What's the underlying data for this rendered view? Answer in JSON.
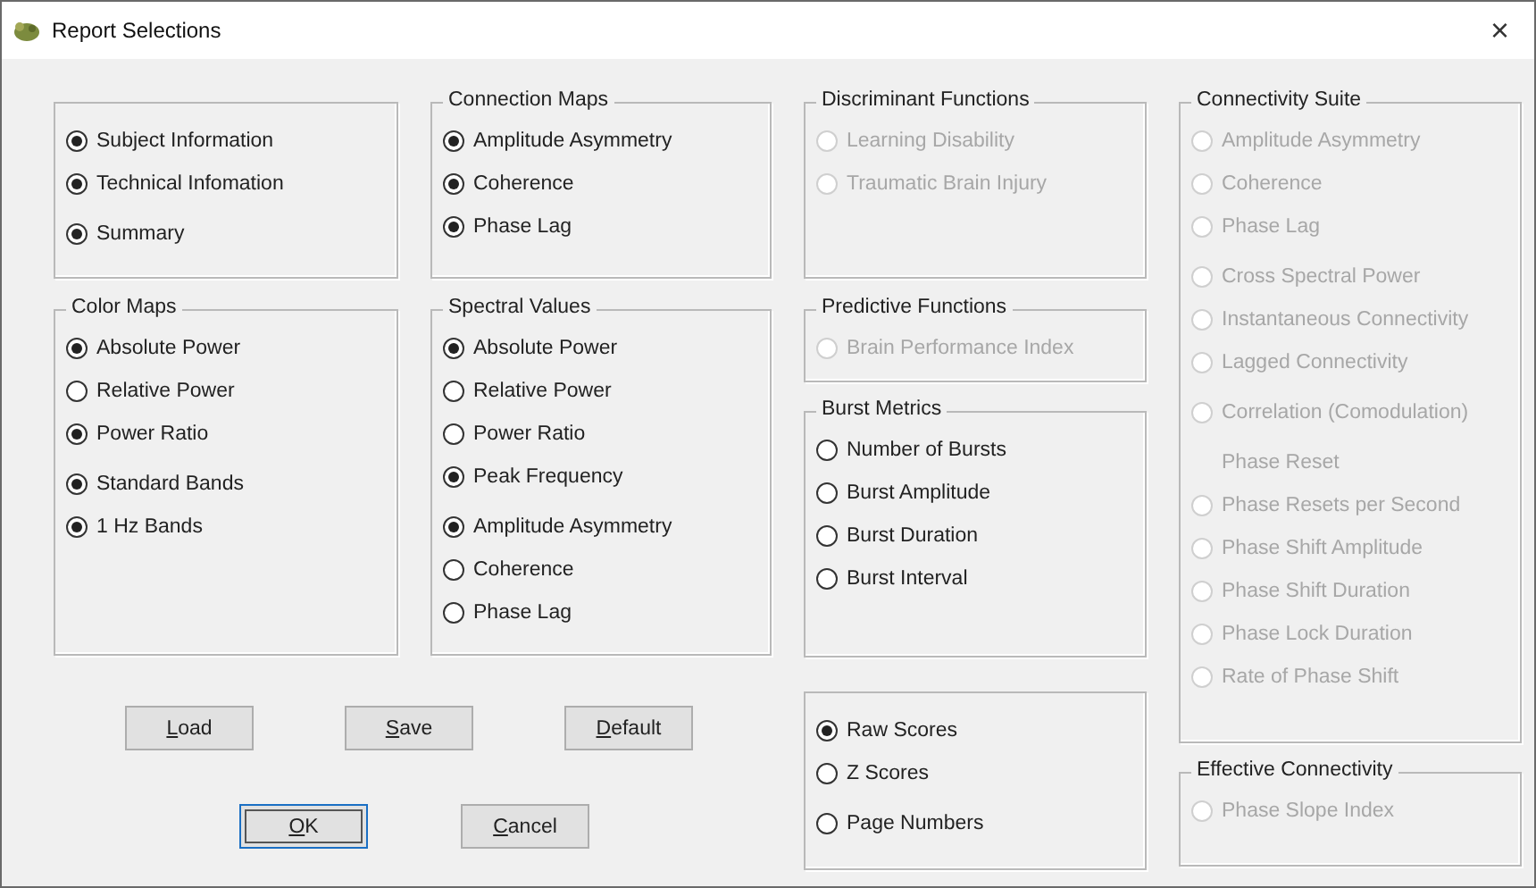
{
  "window": {
    "title": "Report Selections",
    "close": "×"
  },
  "columns": [
    {
      "groups": [
        {
          "sets": [
            [
              {
                "label": "Subject Information",
                "selected": true,
                "disabled": false
              },
              {
                "label": "Technical Infomation",
                "selected": true,
                "disabled": false
              }
            ],
            [
              {
                "label": "Summary",
                "selected": true,
                "disabled": false
              }
            ]
          ]
        },
        {
          "title": "Color Maps",
          "sets": [
            [
              {
                "label": "Absolute Power",
                "selected": true,
                "disabled": false
              },
              {
                "label": "Relative Power",
                "selected": false,
                "disabled": false
              },
              {
                "label": "Power Ratio",
                "selected": true,
                "disabled": false
              }
            ],
            [
              {
                "label": "Standard Bands",
                "selected": true,
                "disabled": false
              },
              {
                "label": "1 Hz Bands",
                "selected": true,
                "disabled": false
              }
            ]
          ]
        }
      ]
    },
    {
      "groups": [
        {
          "title": "Connection Maps",
          "sets": [
            [
              {
                "label": "Amplitude Asymmetry",
                "selected": true,
                "disabled": false
              },
              {
                "label": "Coherence",
                "selected": true,
                "disabled": false
              },
              {
                "label": "Phase Lag",
                "selected": true,
                "disabled": false
              }
            ]
          ]
        },
        {
          "title": "Spectral Values",
          "sets": [
            [
              {
                "label": "Absolute Power",
                "selected": true,
                "disabled": false
              },
              {
                "label": "Relative Power",
                "selected": false,
                "disabled": false
              },
              {
                "label": "Power Ratio",
                "selected": false,
                "disabled": false
              },
              {
                "label": "Peak Frequency",
                "selected": true,
                "disabled": false
              }
            ],
            [
              {
                "label": "Amplitude Asymmetry",
                "selected": true,
                "disabled": false
              },
              {
                "label": "Coherence",
                "selected": false,
                "disabled": false
              },
              {
                "label": "Phase Lag",
                "selected": false,
                "disabled": false
              }
            ]
          ]
        }
      ]
    },
    {
      "groups": [
        {
          "title": "Discriminant Functions",
          "sets": [
            [
              {
                "label": "Learning Disability",
                "selected": false,
                "disabled": true
              },
              {
                "label": "Traumatic Brain Injury",
                "selected": false,
                "disabled": true
              }
            ]
          ]
        },
        {
          "title": "Predictive Functions",
          "sets": [
            [
              {
                "label": "Brain Performance Index",
                "selected": false,
                "disabled": true
              }
            ]
          ]
        },
        {
          "title": "Burst Metrics",
          "sets": [
            [
              {
                "label": "Number of Bursts",
                "selected": false,
                "disabled": false
              },
              {
                "label": "Burst Amplitude",
                "selected": false,
                "disabled": false
              },
              {
                "label": "Burst Duration",
                "selected": false,
                "disabled": false
              },
              {
                "label": "Burst Interval",
                "selected": false,
                "disabled": false
              }
            ]
          ]
        },
        {
          "sets": [
            [
              {
                "label": "Raw Scores",
                "selected": true,
                "disabled": false
              },
              {
                "label": "Z Scores",
                "selected": false,
                "disabled": false
              }
            ],
            [
              {
                "label": "Page Numbers",
                "selected": false,
                "disabled": false
              }
            ]
          ]
        }
      ]
    },
    {
      "groups": [
        {
          "title": "Connectivity Suite",
          "sets": [
            [
              {
                "label": "Amplitude Asymmetry",
                "selected": false,
                "disabled": true
              },
              {
                "label": "Coherence",
                "selected": false,
                "disabled": true
              },
              {
                "label": "Phase Lag",
                "selected": false,
                "disabled": true
              }
            ],
            [
              {
                "label": "Cross Spectral Power",
                "selected": false,
                "disabled": true
              },
              {
                "label": "Instantaneous Connectivity",
                "selected": false,
                "disabled": true
              },
              {
                "label": "Lagged Connectivity",
                "selected": false,
                "disabled": true
              }
            ],
            [
              {
                "label": "Correlation (Comodulation)",
                "selected": false,
                "disabled": true
              }
            ],
            [
              {
                "kind": "label",
                "label": "Phase Reset",
                "disabled": true
              },
              {
                "label": "Phase Resets per Second",
                "selected": false,
                "disabled": true
              },
              {
                "label": "Phase Shift Amplitude",
                "selected": false,
                "disabled": true
              },
              {
                "label": "Phase Shift Duration",
                "selected": false,
                "disabled": true
              },
              {
                "label": "Phase Lock Duration",
                "selected": false,
                "disabled": true
              },
              {
                "label": "Rate of Phase Shift",
                "selected": false,
                "disabled": true
              }
            ]
          ]
        },
        {
          "title": "Effective Connectivity",
          "sets": [
            [
              {
                "label": "Phase Slope Index",
                "selected": false,
                "disabled": true
              }
            ]
          ]
        }
      ]
    }
  ],
  "button_rows": [
    {
      "buttons": [
        {
          "label": "Load",
          "mnemonic": true,
          "focused": false
        },
        {
          "label": "Save",
          "mnemonic": true,
          "focused": false
        },
        {
          "label": "Default",
          "mnemonic": true,
          "focused": false
        }
      ]
    },
    {
      "buttons": [
        {
          "label": "OK",
          "mnemonic": true,
          "focused": true
        },
        {
          "label": "Cancel",
          "mnemonic": true,
          "focused": false
        }
      ]
    }
  ]
}
